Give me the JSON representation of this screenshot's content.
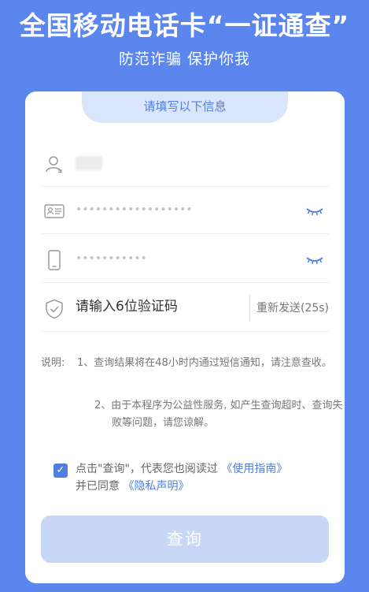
{
  "header": {
    "title": "全国移动电话卡“一证通查”",
    "subtitle": "防范诈骗 保护你我"
  },
  "form": {
    "section_label": "请填写以下信息",
    "id_number_masked": "••••••••••••••••••",
    "phone_masked": "•••••••••••",
    "code_placeholder": "请输入6位验证码",
    "resend_label": "重新发送(25s)"
  },
  "notes": {
    "label": "说明:",
    "item1": "1、查询结果将在48小时内通过短信通知，请注意查收。",
    "item2": "2、由于本程序为公益性服务, 如产生查询超时、查询失败等问题，请您谅解。"
  },
  "agreement": {
    "checked": true,
    "text_1": "点击\"查询\"，代表您也阅读过",
    "link_1": "《使用指南》",
    "text_2": "并已同意",
    "link_2": "《隐私声明》"
  },
  "submit_label": "查询",
  "colors": {
    "background": "#5b86ee",
    "accent": "#4f7fe0",
    "button_disabled": "#c9d7f6"
  }
}
